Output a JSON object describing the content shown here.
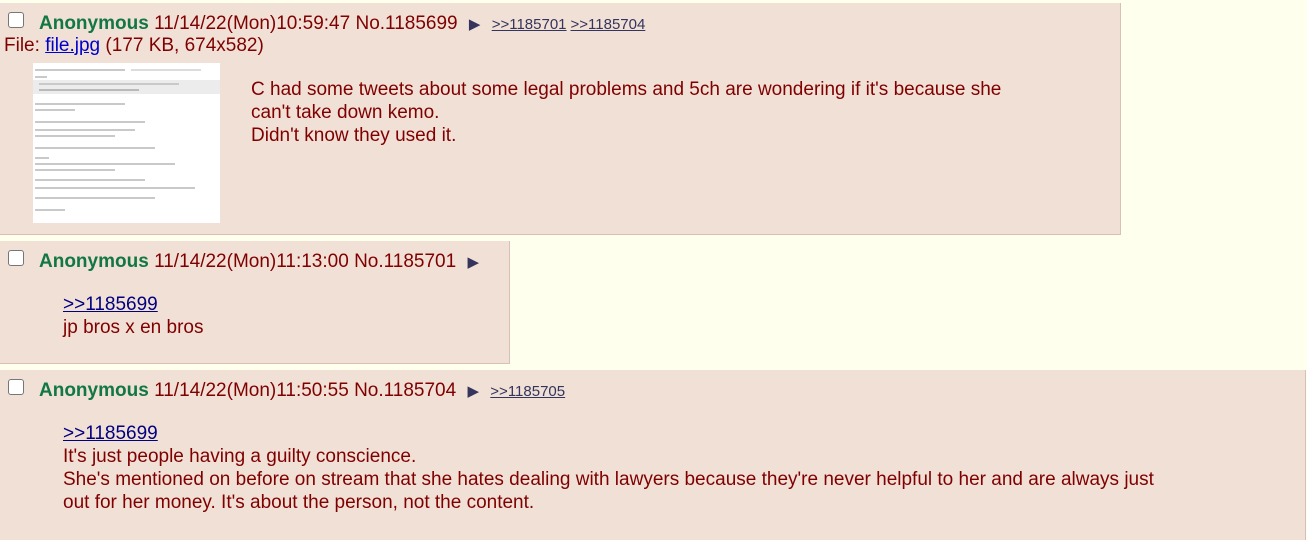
{
  "posts": [
    {
      "name": "Anonymous",
      "datetime": "11/14/22(Mon)10:59:47",
      "number": "No.1185699",
      "backlinks": [
        ">>1185701",
        ">>1185704"
      ],
      "file_label": "File: ",
      "file_name": "file.jpg",
      "file_meta": "(177 KB, 674x582)",
      "lines": [
        "C had some tweets about some legal problems and 5ch are wondering if it's because she",
        "can't take down kemo.",
        "Didn't know they used it."
      ]
    },
    {
      "name": "Anonymous",
      "datetime": "11/14/22(Mon)11:13:00",
      "number": "No.1185701",
      "quote": ">>1185699",
      "lines": [
        "jp bros x en bros"
      ]
    },
    {
      "name": "Anonymous",
      "datetime": "11/14/22(Mon)11:50:55",
      "number": "No.1185704",
      "backlinks": [
        ">>1185705"
      ],
      "quote": ">>1185699",
      "lines": [
        "It's just people having a guilty conscience.",
        "She's mentioned on before on stream that she hates dealing with lawyers because they're never helpful to her and are always just",
        "out for her money. It's about the person, not the content."
      ]
    }
  ],
  "icons": {
    "arrow": "play-arrow-icon"
  },
  "colors": {
    "background": "#ffffee",
    "post_bg": "#f0e0d6",
    "name": "#117743",
    "text": "#800000"
  }
}
